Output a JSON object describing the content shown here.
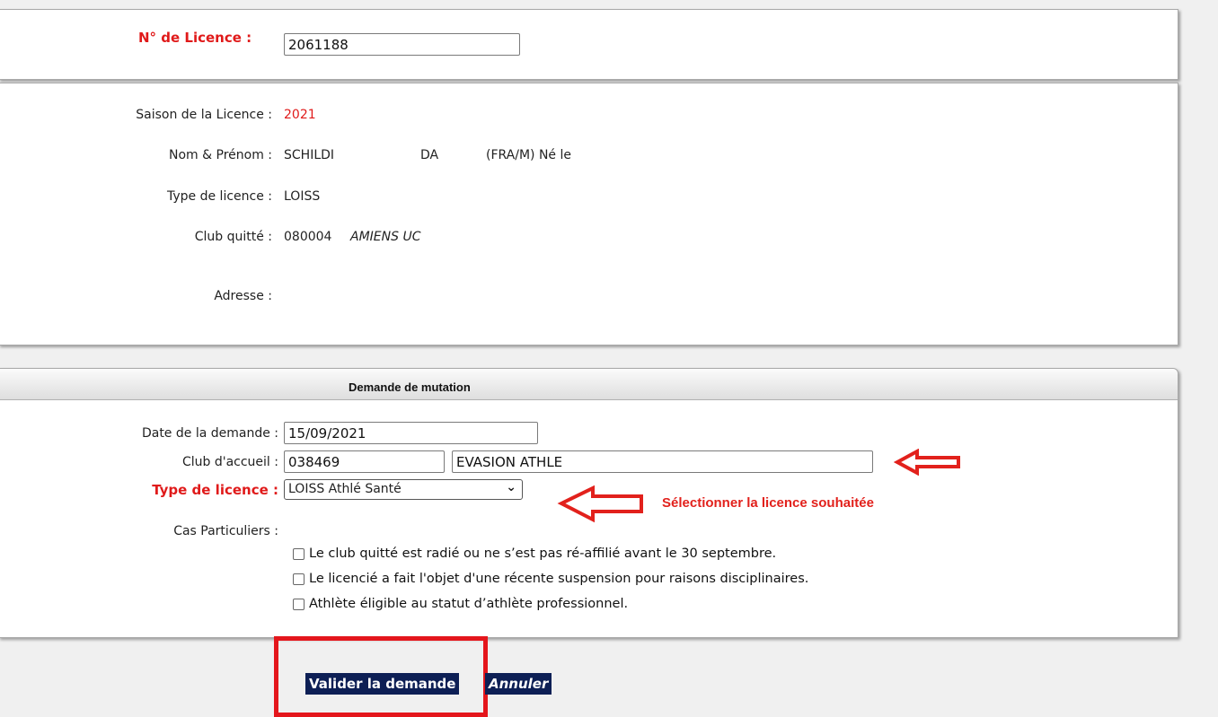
{
  "licence": {
    "label": "N° de Licence :",
    "value": "2061188"
  },
  "info": {
    "saison_label": "Saison de la Licence :",
    "saison_value": "2021",
    "nom_label": "Nom & Prénom :",
    "nom_value": "SCHILDI",
    "prenom_value": "DA",
    "nat_value": "(FRA/M) Né le",
    "type_label": "Type de licence :",
    "type_value": "LOISS",
    "club_label": "Club quitté :",
    "club_code": "080004",
    "club_name": "AMIENS UC",
    "adresse_label": "Adresse :"
  },
  "mutation": {
    "title": "Demande de mutation",
    "date_label": "Date de la demande :",
    "date_value": "15/09/2021",
    "club_label": "Club d'accueil :",
    "club_code": "038469",
    "club_name": "EVASION ATHLE",
    "type_label": "Type de licence :",
    "type_selected": "LOISS Athlé Santé",
    "cas_label": "Cas Particuliers :",
    "checkboxes": [
      "Le club quitté est radié ou ne s’est pas ré-affilié avant le 30 septembre.",
      "Le licencié a fait l'objet d'une récente suspension pour raisons disciplinaires.",
      "Athlète éligible au statut d’athlète professionnel."
    ]
  },
  "annotation": {
    "text": "Sélectionner la licence souhaitée",
    "color": "#e2211c"
  },
  "actions": {
    "valider": "Valider la demande",
    "annuler": "Annuler"
  },
  "colors": {
    "accent_red": "#e01a1a",
    "button_bg": "#0d1f55"
  }
}
